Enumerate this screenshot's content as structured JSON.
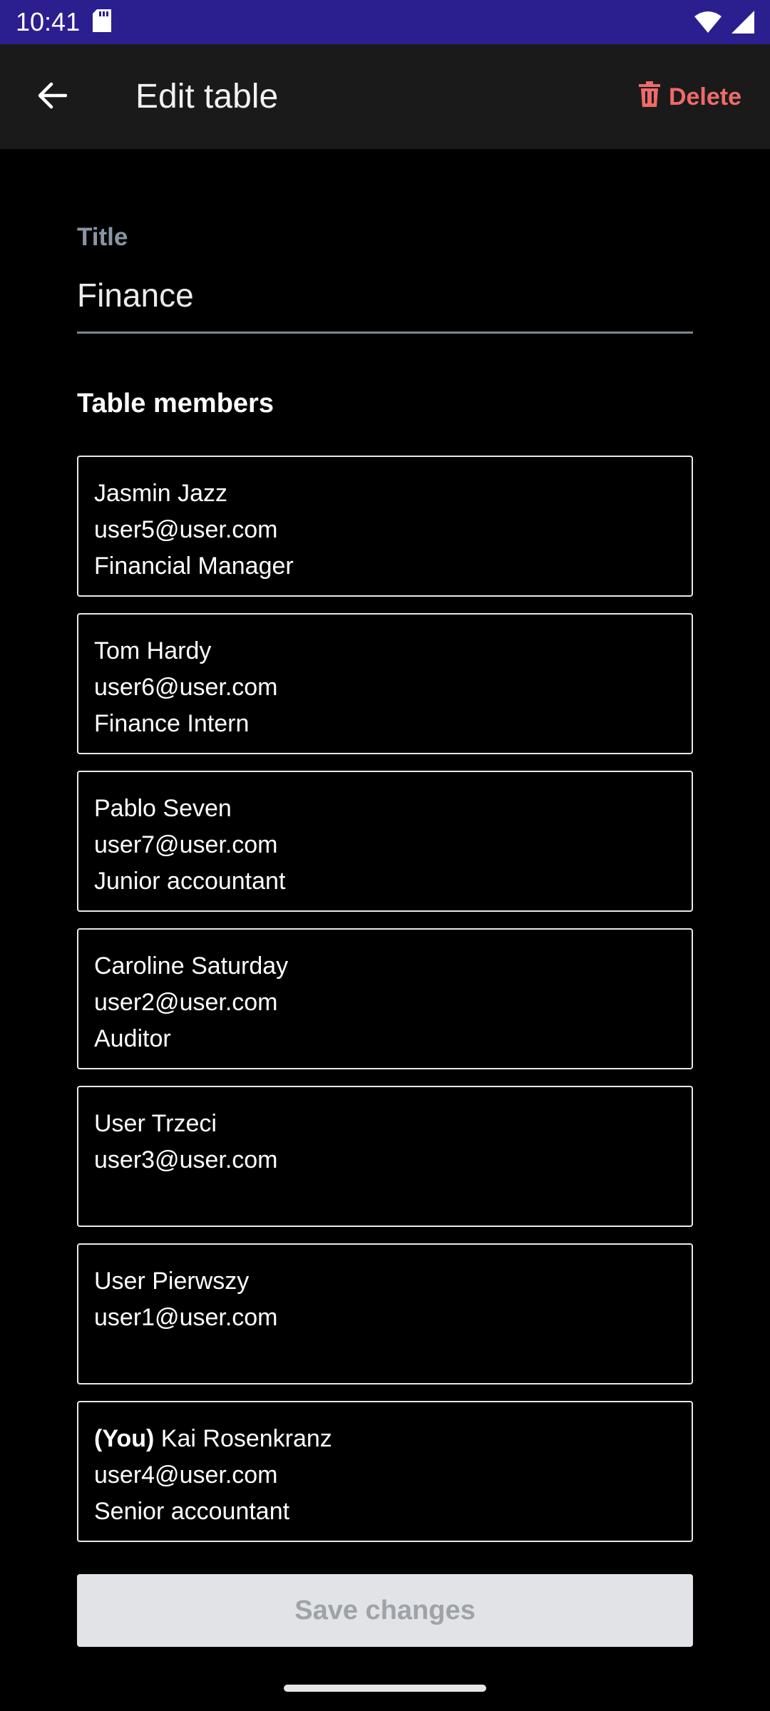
{
  "status_bar": {
    "time": "10:41",
    "icons": [
      "sd-card-icon",
      "wifi-icon",
      "cell-signal-icon"
    ]
  },
  "app_bar": {
    "title": "Edit table",
    "back_icon": "arrow-back-icon",
    "delete_label": "Delete",
    "delete_icon": "trash-icon",
    "delete_color": "#ef6a6a"
  },
  "form": {
    "title_label": "Title",
    "title_value": "Finance",
    "members_heading": "Table members"
  },
  "members": [
    {
      "name": "Jasmin Jazz",
      "email": "user5@user.com",
      "role": "Financial Manager"
    },
    {
      "name": "Tom Hardy",
      "email": "user6@user.com",
      "role": "Finance Intern"
    },
    {
      "name": "Pablo Seven",
      "email": "user7@user.com",
      "role": "Junior accountant"
    },
    {
      "name": "Caroline Saturday",
      "email": "user2@user.com",
      "role": "Auditor"
    },
    {
      "name": "User Trzeci",
      "email": "user3@user.com",
      "role": ""
    },
    {
      "name": "User Pierwszy",
      "email": "user1@user.com",
      "role": ""
    },
    {
      "you_tag": "(You)",
      "name": "Kai Rosenkranz",
      "email": "user4@user.com",
      "role": "Senior accountant"
    }
  ],
  "actions": {
    "save_label": "Save changes"
  },
  "colors": {
    "status_bar": "#2b1f8f",
    "app_bar": "#1a1a1a",
    "background": "#000000",
    "save_button_disabled": "#e1e3e6"
  }
}
